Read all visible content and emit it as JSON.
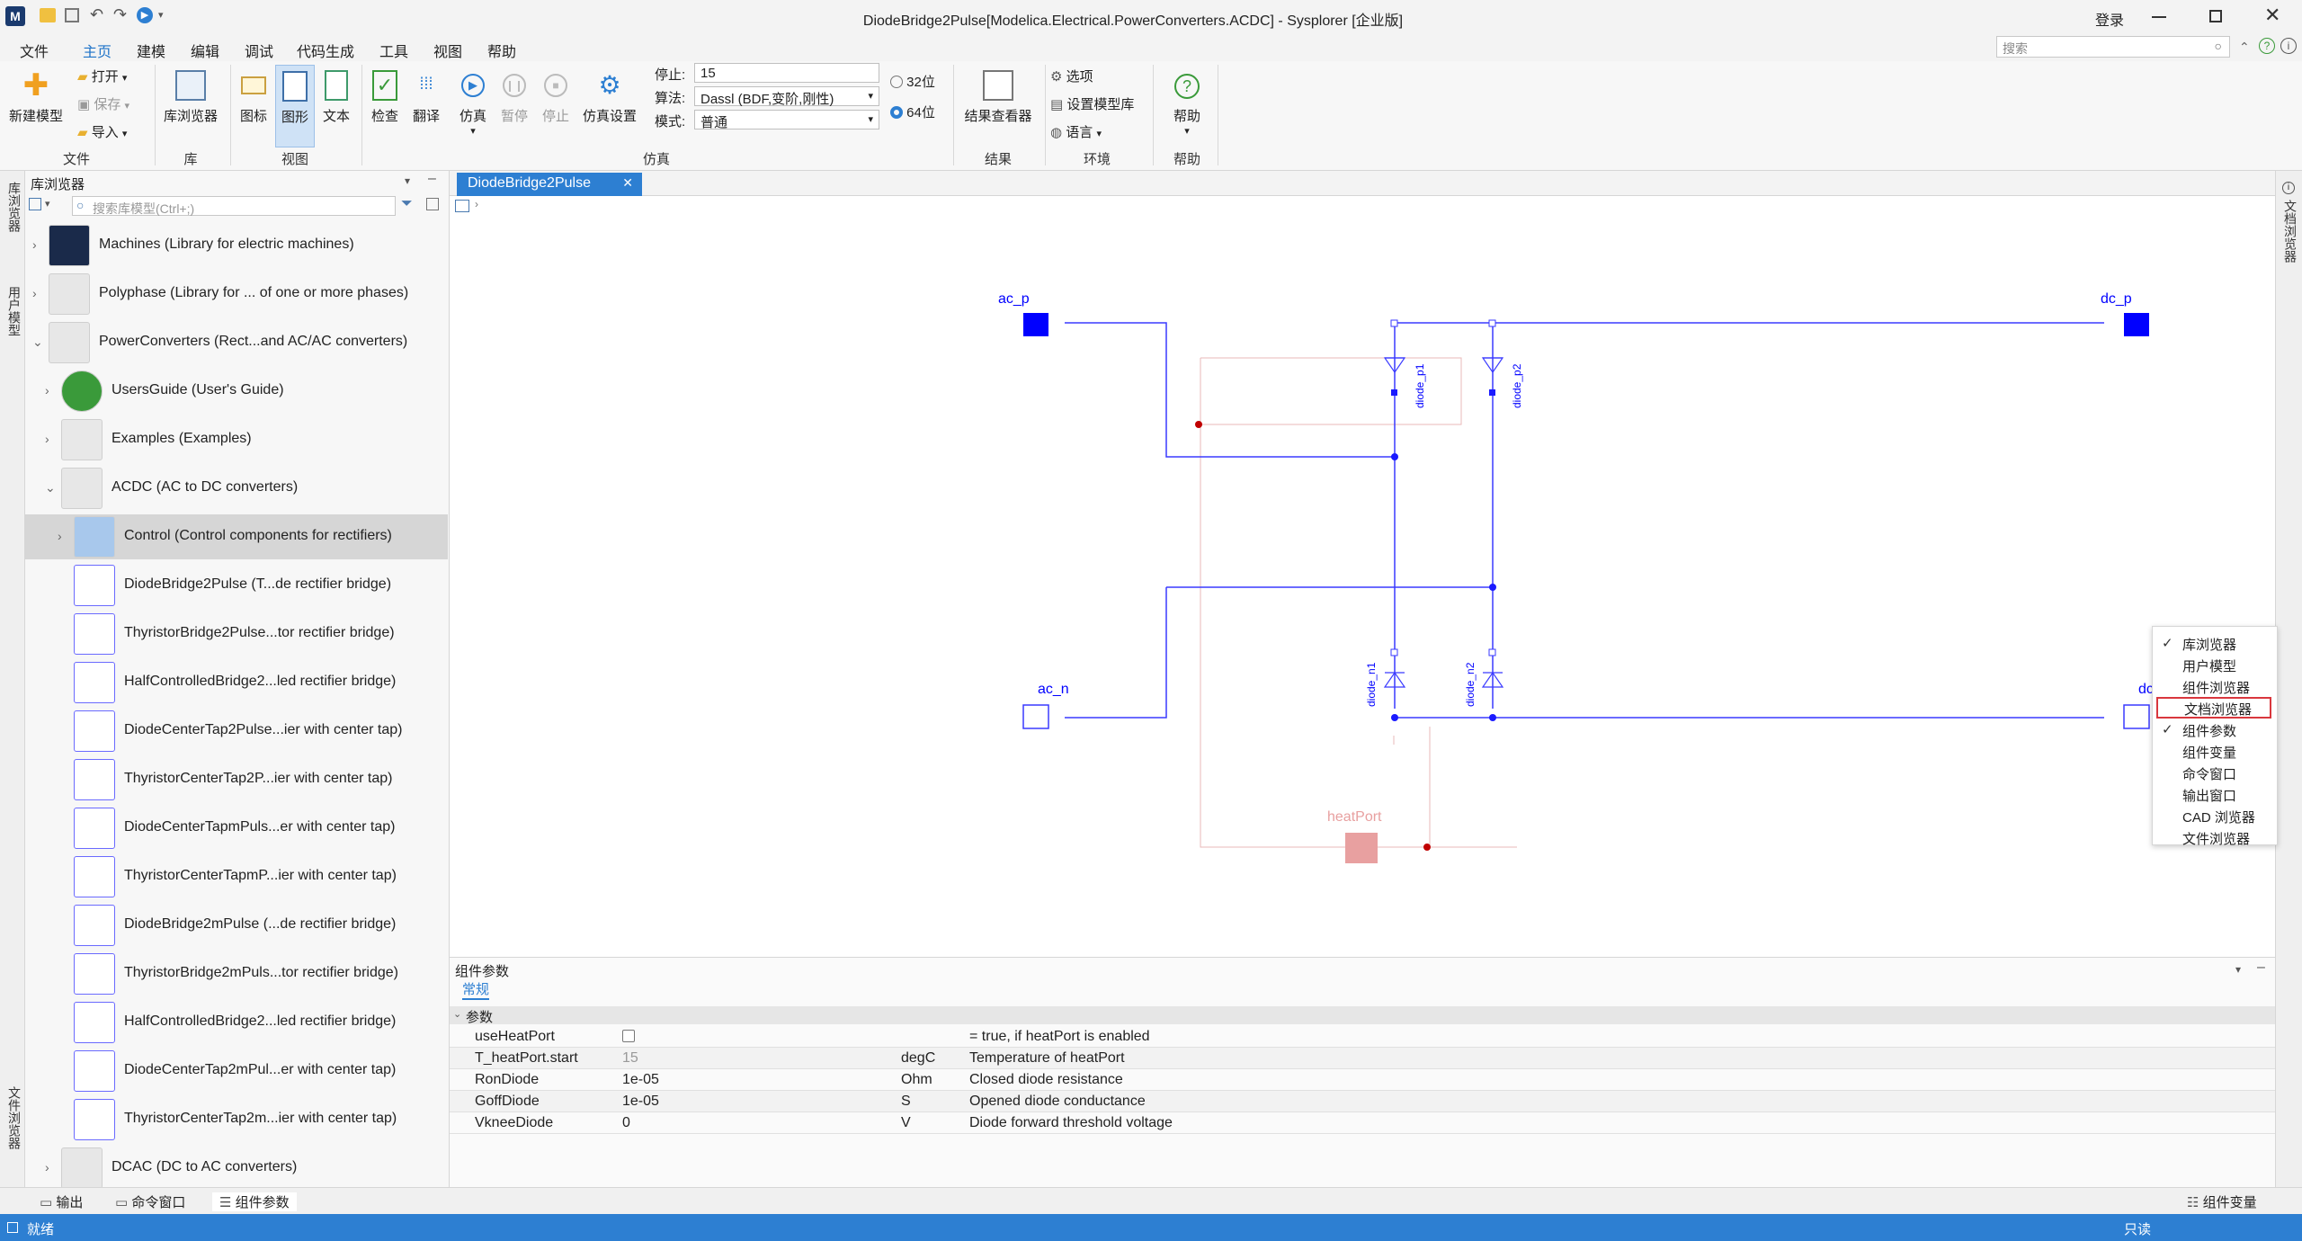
{
  "window": {
    "title": "DiodeBridge2Pulse[Modelica.Electrical.PowerConverters.ACDC] - Sysplorer [企业版]",
    "login": "登录"
  },
  "menubar": [
    "文件",
    "主页",
    "建模",
    "编辑",
    "调试",
    "代码生成",
    "工具",
    "视图",
    "帮助"
  ],
  "menubar_active": "主页",
  "search": {
    "placeholder": "搜索"
  },
  "ribbon": {
    "file": {
      "new_model": "新建模型",
      "open": "打开",
      "save": "保存",
      "import": "导入",
      "group": "文件"
    },
    "library": {
      "lib_browser": "库浏览器",
      "group": "库"
    },
    "view": {
      "icon": "图标",
      "diagram": "图形",
      "text": "文本",
      "group": "视图"
    },
    "sim": {
      "check": "检查",
      "translate": "翻译",
      "simulate": "仿真",
      "pause": "暂停",
      "stop": "停止",
      "settings": "仿真设置",
      "stop_label": "停止:",
      "stop_value": "15",
      "algo_label": "算法:",
      "algo_value": "Dassl (BDF,变阶,刚性)",
      "mode_label": "模式:",
      "mode_value": "普通",
      "bit32": "32位",
      "bit64": "64位",
      "group": "仿真"
    },
    "result": {
      "viewer": "结果查看器",
      "group": "结果"
    },
    "env": {
      "options": "选项",
      "set_lib": "设置模型库",
      "language": "语言",
      "group": "环境"
    },
    "help": {
      "help": "帮助",
      "group": "帮助"
    }
  },
  "left_strip": {
    "lib": "库浏览器",
    "user": "用户模型",
    "file": "文件浏览器"
  },
  "library_panel": {
    "title": "库浏览器",
    "search_placeholder": "搜索库模型(Ctrl+;)",
    "items": [
      {
        "label": "Machines (Library for electric machines)"
      },
      {
        "label": "Polyphase (Library for ... of one or more phases)"
      },
      {
        "label": "PowerConverters (Rect...and AC/AC converters)"
      },
      {
        "label": "UsersGuide (User's Guide)"
      },
      {
        "label": "Examples (Examples)"
      },
      {
        "label": "ACDC (AC to DC converters)"
      },
      {
        "label": "Control (Control components for rectifiers)"
      },
      {
        "label": "DiodeBridge2Pulse (T...de rectifier bridge)"
      },
      {
        "label": "ThyristorBridge2Pulse...tor rectifier bridge)"
      },
      {
        "label": "HalfControlledBridge2...led rectifier bridge)"
      },
      {
        "label": "DiodeCenterTap2Pulse...ier with center tap)"
      },
      {
        "label": "ThyristorCenterTap2P...ier with center tap)"
      },
      {
        "label": "DiodeCenterTapmPuls...er with center tap)"
      },
      {
        "label": "ThyristorCenterTapmP...ier with center tap)"
      },
      {
        "label": "DiodeBridge2mPulse (...de rectifier bridge)"
      },
      {
        "label": "ThyristorBridge2mPuls...tor rectifier bridge)"
      },
      {
        "label": "HalfControlledBridge2...led rectifier bridge)"
      },
      {
        "label": "DiodeCenterTap2mPul...er with center tap)"
      },
      {
        "label": "ThyristorCenterTap2m...ier with center tap)"
      },
      {
        "label": "DCAC (DC to AC converters)"
      }
    ]
  },
  "editor": {
    "tab": "DiodeBridge2Pulse",
    "labels": {
      "ac_p": "ac_p",
      "dc_p": "dc_p",
      "ac_n": "ac_n",
      "dc_n": "dc_n",
      "heatPort": "heatPort",
      "diode_p1": "diode_p1",
      "diode_p2": "diode_p2",
      "diode_n1": "diode_n1",
      "diode_n2": "diode_n2"
    }
  },
  "params": {
    "title": "组件参数",
    "tab": "常规",
    "section": "参数",
    "rows": [
      {
        "name": "useHeatPort",
        "value": "",
        "unit": "",
        "desc": "= true, if heatPort is enabled"
      },
      {
        "name": "T_heatPort.start",
        "value": "15",
        "unit": "degC",
        "desc": "Temperature of heatPort"
      },
      {
        "name": "RonDiode",
        "value": "1e-05",
        "unit": "Ohm",
        "desc": "Closed diode resistance"
      },
      {
        "name": "GoffDiode",
        "value": "1e-05",
        "unit": "S",
        "desc": "Opened diode conductance"
      },
      {
        "name": "VkneeDiode",
        "value": "0",
        "unit": "V",
        "desc": "Diode forward threshold voltage"
      }
    ]
  },
  "right_strip": {
    "doc": "文档浏览器"
  },
  "context_menu": [
    {
      "label": "库浏览器",
      "checked": "✓"
    },
    {
      "label": "用户模型",
      "checked": ""
    },
    {
      "label": "组件浏览器",
      "checked": ""
    },
    {
      "label": "文档浏览器",
      "checked": ""
    },
    {
      "label": "组件参数",
      "checked": "✓"
    },
    {
      "label": "组件变量",
      "checked": ""
    },
    {
      "label": "命令窗口",
      "checked": ""
    },
    {
      "label": "输出窗口",
      "checked": ""
    },
    {
      "label": "CAD 浏览器",
      "checked": ""
    },
    {
      "label": "文件浏览器",
      "checked": ""
    }
  ],
  "bottom_tabs": {
    "output": "输出",
    "command": "命令窗口",
    "params": "组件参数",
    "vars": "组件变量"
  },
  "status": {
    "ready": "就绪",
    "readonly": "只读"
  },
  "colors": {
    "accent": "#2d7fd2",
    "wire": "#0000ff",
    "heat": "#e8a0a0",
    "highlight": "#d9373d"
  }
}
